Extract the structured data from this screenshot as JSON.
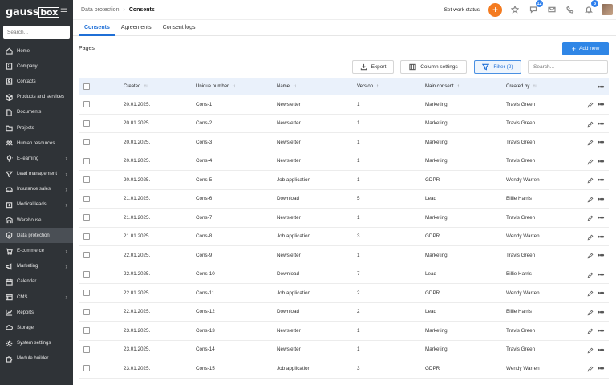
{
  "app": {
    "logo_text": "gauss",
    "logo_box": "box"
  },
  "sidebar": {
    "search_placeholder": "Search...",
    "items": [
      {
        "label": "Home",
        "icon": "home-icon",
        "chevron": false
      },
      {
        "label": "Company",
        "icon": "building-icon",
        "chevron": false
      },
      {
        "label": "Contacts",
        "icon": "contacts-icon",
        "chevron": false
      },
      {
        "label": "Products and services",
        "icon": "box-icon",
        "chevron": false
      },
      {
        "label": "Documents",
        "icon": "document-icon",
        "chevron": false
      },
      {
        "label": "Projects",
        "icon": "folder-icon",
        "chevron": false
      },
      {
        "label": "Human resources",
        "icon": "people-icon",
        "chevron": false
      },
      {
        "label": "E-learning",
        "icon": "bulb-icon",
        "chevron": true
      },
      {
        "label": "Lead management",
        "icon": "funnel-icon",
        "chevron": true
      },
      {
        "label": "Insurance sales",
        "icon": "car-icon",
        "chevron": true
      },
      {
        "label": "Medical leads",
        "icon": "medical-icon",
        "chevron": true
      },
      {
        "label": "Warehouse",
        "icon": "warehouse-icon",
        "chevron": false
      },
      {
        "label": "Data protection",
        "icon": "shield-icon",
        "chevron": false,
        "active": true
      },
      {
        "label": "E-commerce",
        "icon": "cart-icon",
        "chevron": true
      },
      {
        "label": "Marketing",
        "icon": "megaphone-icon",
        "chevron": true
      },
      {
        "label": "Calendar",
        "icon": "calendar-icon",
        "chevron": false
      },
      {
        "label": "CMS",
        "icon": "cms-icon",
        "chevron": true
      },
      {
        "label": "Reports",
        "icon": "chart-icon",
        "chevron": false
      },
      {
        "label": "Storage",
        "icon": "cloud-icon",
        "chevron": false
      },
      {
        "label": "System settings",
        "icon": "gear-icon",
        "chevron": false
      },
      {
        "label": "Module builder",
        "icon": "puzzle-icon",
        "chevron": false
      }
    ]
  },
  "header": {
    "breadcrumb_parent": "Data protection",
    "breadcrumb_current": "Consents",
    "work_status": "Set work status",
    "plus": "+",
    "badges": {
      "chat": "12",
      "bell": "3"
    }
  },
  "tabs": [
    "Consents",
    "Agreements",
    "Consent logs"
  ],
  "page": {
    "title": "Pages",
    "add_new": "Add new",
    "add_plus": "+",
    "export": "Export",
    "column_settings": "Column settings",
    "filter": "Filter (2)",
    "search_placeholder": "Search..."
  },
  "table": {
    "columns": [
      "Created",
      "Unique number",
      "Name",
      "Version",
      "Main consent",
      "Created by"
    ],
    "more": "•••",
    "rows": [
      [
        "20.01.2025.",
        "Cons-1",
        "Newsletter",
        "1",
        "Marketing",
        "Travis Green"
      ],
      [
        "20.01.2025.",
        "Cons-2",
        "Newsletter",
        "1",
        "Marketing",
        "Travis Green"
      ],
      [
        "20.01.2025.",
        "Cons-3",
        "Newsletter",
        "1",
        "Marketing",
        "Travis Green"
      ],
      [
        "20.01.2025.",
        "Cons-4",
        "Newsletter",
        "1",
        "Marketing",
        "Travis Green"
      ],
      [
        "20.01.2025.",
        "Cons-5",
        "Job application",
        "1",
        "GDPR",
        "Wendy Warren"
      ],
      [
        "21.01.2025.",
        "Cons-6",
        "Download",
        "5",
        "Lead",
        "Billie Harris"
      ],
      [
        "21.01.2025.",
        "Cons-7",
        "Newsletter",
        "1",
        "Marketing",
        "Travis Green"
      ],
      [
        "21.01.2025.",
        "Cons-8",
        "Job application",
        "3",
        "GDPR",
        "Wendy Warren"
      ],
      [
        "22.01.2025.",
        "Cons-9",
        "Newsletter",
        "1",
        "Marketing",
        "Travis Green"
      ],
      [
        "22.01.2025.",
        "Cons-10",
        "Download",
        "7",
        "Lead",
        "Billie Harris"
      ],
      [
        "22.01.2025.",
        "Cons-11",
        "Job application",
        "2",
        "GDPR",
        "Wendy Warren"
      ],
      [
        "22.01.2025.",
        "Cons-12",
        "Download",
        "2",
        "Lead",
        "Billie Harris"
      ],
      [
        "23.01.2025.",
        "Cons-13",
        "Newsletter",
        "1",
        "Marketing",
        "Travis Green"
      ],
      [
        "23.01.2025.",
        "Cons-14",
        "Newsletter",
        "1",
        "Marketing",
        "Travis Green"
      ],
      [
        "23.01.2025.",
        "Cons-15",
        "Job application",
        "3",
        "GDPR",
        "Wendy Warren"
      ]
    ]
  },
  "colors": {
    "accent": "#2f86e6",
    "orange": "#f47b20",
    "sidebar": "#2f3337"
  }
}
